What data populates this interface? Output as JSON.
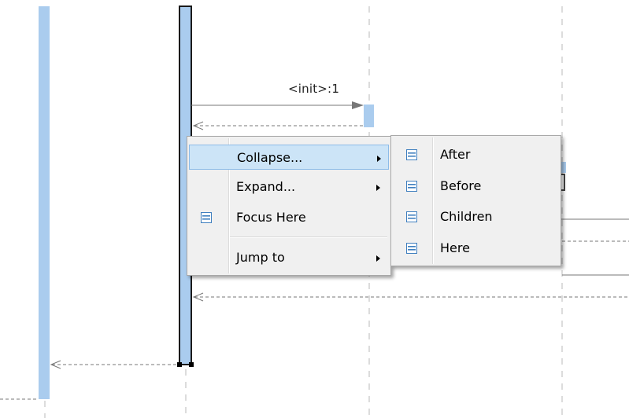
{
  "diagram": {
    "message_label": "<init>:1"
  },
  "context_menu": {
    "items": [
      {
        "label": "Collapse...",
        "icon": "none",
        "submenu": true,
        "highlighted": true
      },
      {
        "label": "Expand...",
        "icon": "none",
        "submenu": true,
        "highlighted": false
      },
      {
        "label": "Focus Here",
        "icon": "collapse-box-icon",
        "submenu": false,
        "highlighted": false
      },
      {
        "label": "Jump to",
        "icon": "none",
        "submenu": true,
        "highlighted": false
      }
    ]
  },
  "submenu": {
    "items": [
      {
        "label": "After",
        "icon": "collapse-box-icon"
      },
      {
        "label": "Before",
        "icon": "collapse-box-icon"
      },
      {
        "label": "Children",
        "icon": "collapse-box-icon"
      },
      {
        "label": "Here",
        "icon": "collapse-box-icon"
      }
    ]
  },
  "colors": {
    "activation_bar": "#aaccee",
    "lifeline_dash": "#b8b8b8",
    "menu_background": "#f0f0f0",
    "menu_highlight": "#cce4f7",
    "icon_blue": "#3f7fbf"
  }
}
